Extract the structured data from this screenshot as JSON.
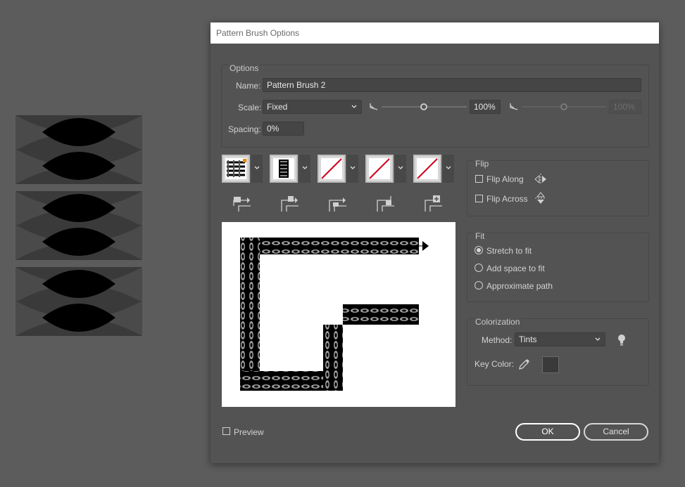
{
  "window": {
    "title": "Pattern Brush Options"
  },
  "options": {
    "group_title": "Options",
    "name_label": "Name:",
    "name_value": "Pattern Brush 2",
    "scale_label": "Scale:",
    "scale_mode": "Fixed",
    "scale_value": "100%",
    "scale_value_2": "100%",
    "scale_slider_fraction": 0.55,
    "spacing_label": "Spacing:",
    "spacing_value": "0%"
  },
  "tiles": [
    {
      "name": "side-tile",
      "icon": "pattern-tile-icon"
    },
    {
      "name": "outer-corner-tile",
      "icon": "pattern-tile-icon"
    },
    {
      "name": "inner-corner-tile",
      "icon": "none-icon"
    },
    {
      "name": "start-tile",
      "icon": "none-icon"
    },
    {
      "name": "end-tile",
      "icon": "none-icon"
    }
  ],
  "flip": {
    "group_title": "Flip",
    "along_label": "Flip Along",
    "along_checked": false,
    "across_label": "Flip Across",
    "across_checked": false
  },
  "fit": {
    "group_title": "Fit",
    "options": [
      "Stretch to fit",
      "Add space to fit",
      "Approximate path"
    ],
    "selected": "Stretch to fit"
  },
  "colorization": {
    "group_title": "Colorization",
    "method_label": "Method:",
    "method_value": "Tints",
    "key_color_label": "Key Color:",
    "key_color": "#3a3a3a"
  },
  "footer": {
    "preview_label": "Preview",
    "preview_checked": false,
    "ok_label": "OK",
    "cancel_label": "Cancel"
  }
}
